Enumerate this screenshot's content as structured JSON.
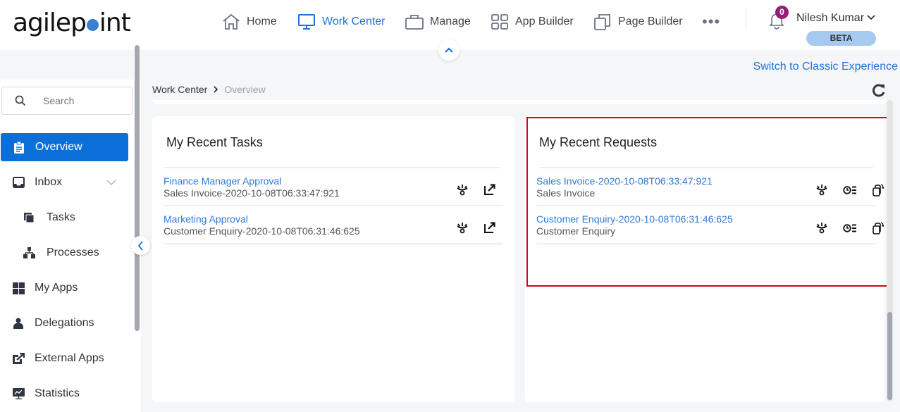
{
  "header": {
    "logo_text_pre": "agilep",
    "logo_text_post": "int",
    "nav": [
      {
        "label": "Home",
        "icon": "home-icon",
        "active": false
      },
      {
        "label": "Work Center",
        "icon": "monitor-icon",
        "active": true
      },
      {
        "label": "Manage",
        "icon": "briefcase-icon",
        "active": false
      },
      {
        "label": "App Builder",
        "icon": "grid-icon",
        "active": false
      },
      {
        "label": "Page Builder",
        "icon": "copy-pages-icon",
        "active": false
      }
    ],
    "more_label": "•••",
    "notification_count": "0",
    "user_name": "Nilesh Kumar",
    "beta_label": "BETA",
    "switch_link": "Switch to Classic Experience"
  },
  "sidebar": {
    "search_placeholder": "Search",
    "items": [
      {
        "label": "Overview",
        "icon": "clipboard-icon",
        "active": true
      },
      {
        "label": "Inbox",
        "icon": "inbox-icon",
        "expandable": true
      },
      {
        "label": "Tasks",
        "icon": "tasks-icon",
        "sub": true
      },
      {
        "label": "Processes",
        "icon": "processes-icon",
        "sub": true
      },
      {
        "label": "My Apps",
        "icon": "apps-grid-icon"
      },
      {
        "label": "Delegations",
        "icon": "user-icon"
      },
      {
        "label": "External Apps",
        "icon": "external-apps-icon"
      },
      {
        "label": "Statistics",
        "icon": "statistics-icon"
      }
    ]
  },
  "breadcrumb": {
    "parent": "Work Center",
    "separator": "›",
    "current": "Overview"
  },
  "recent_tasks": {
    "title": "My Recent Tasks",
    "rows": [
      {
        "title": "Finance Manager Approval",
        "subtitle": "Sales Invoice-2020-10-08T06:33:47:921"
      },
      {
        "title": "Marketing Approval",
        "subtitle": "Customer Enquiry-2020-10-08T06:31:46:625"
      }
    ]
  },
  "recent_requests": {
    "title": "My Recent Requests",
    "rows": [
      {
        "title": "Sales Invoice-2020-10-08T06:33:47:921",
        "subtitle": "Sales Invoice"
      },
      {
        "title": "Customer Enquiry-2020-10-08T06:31:46:625",
        "subtitle": "Customer Enquiry"
      }
    ]
  },
  "colors": {
    "accent": "#1f73d8",
    "active_sidebar": "#0b6fd9",
    "highlight_border": "#d9001b",
    "badge": "#9b1b76",
    "beta_bg": "#a6c9ef"
  }
}
